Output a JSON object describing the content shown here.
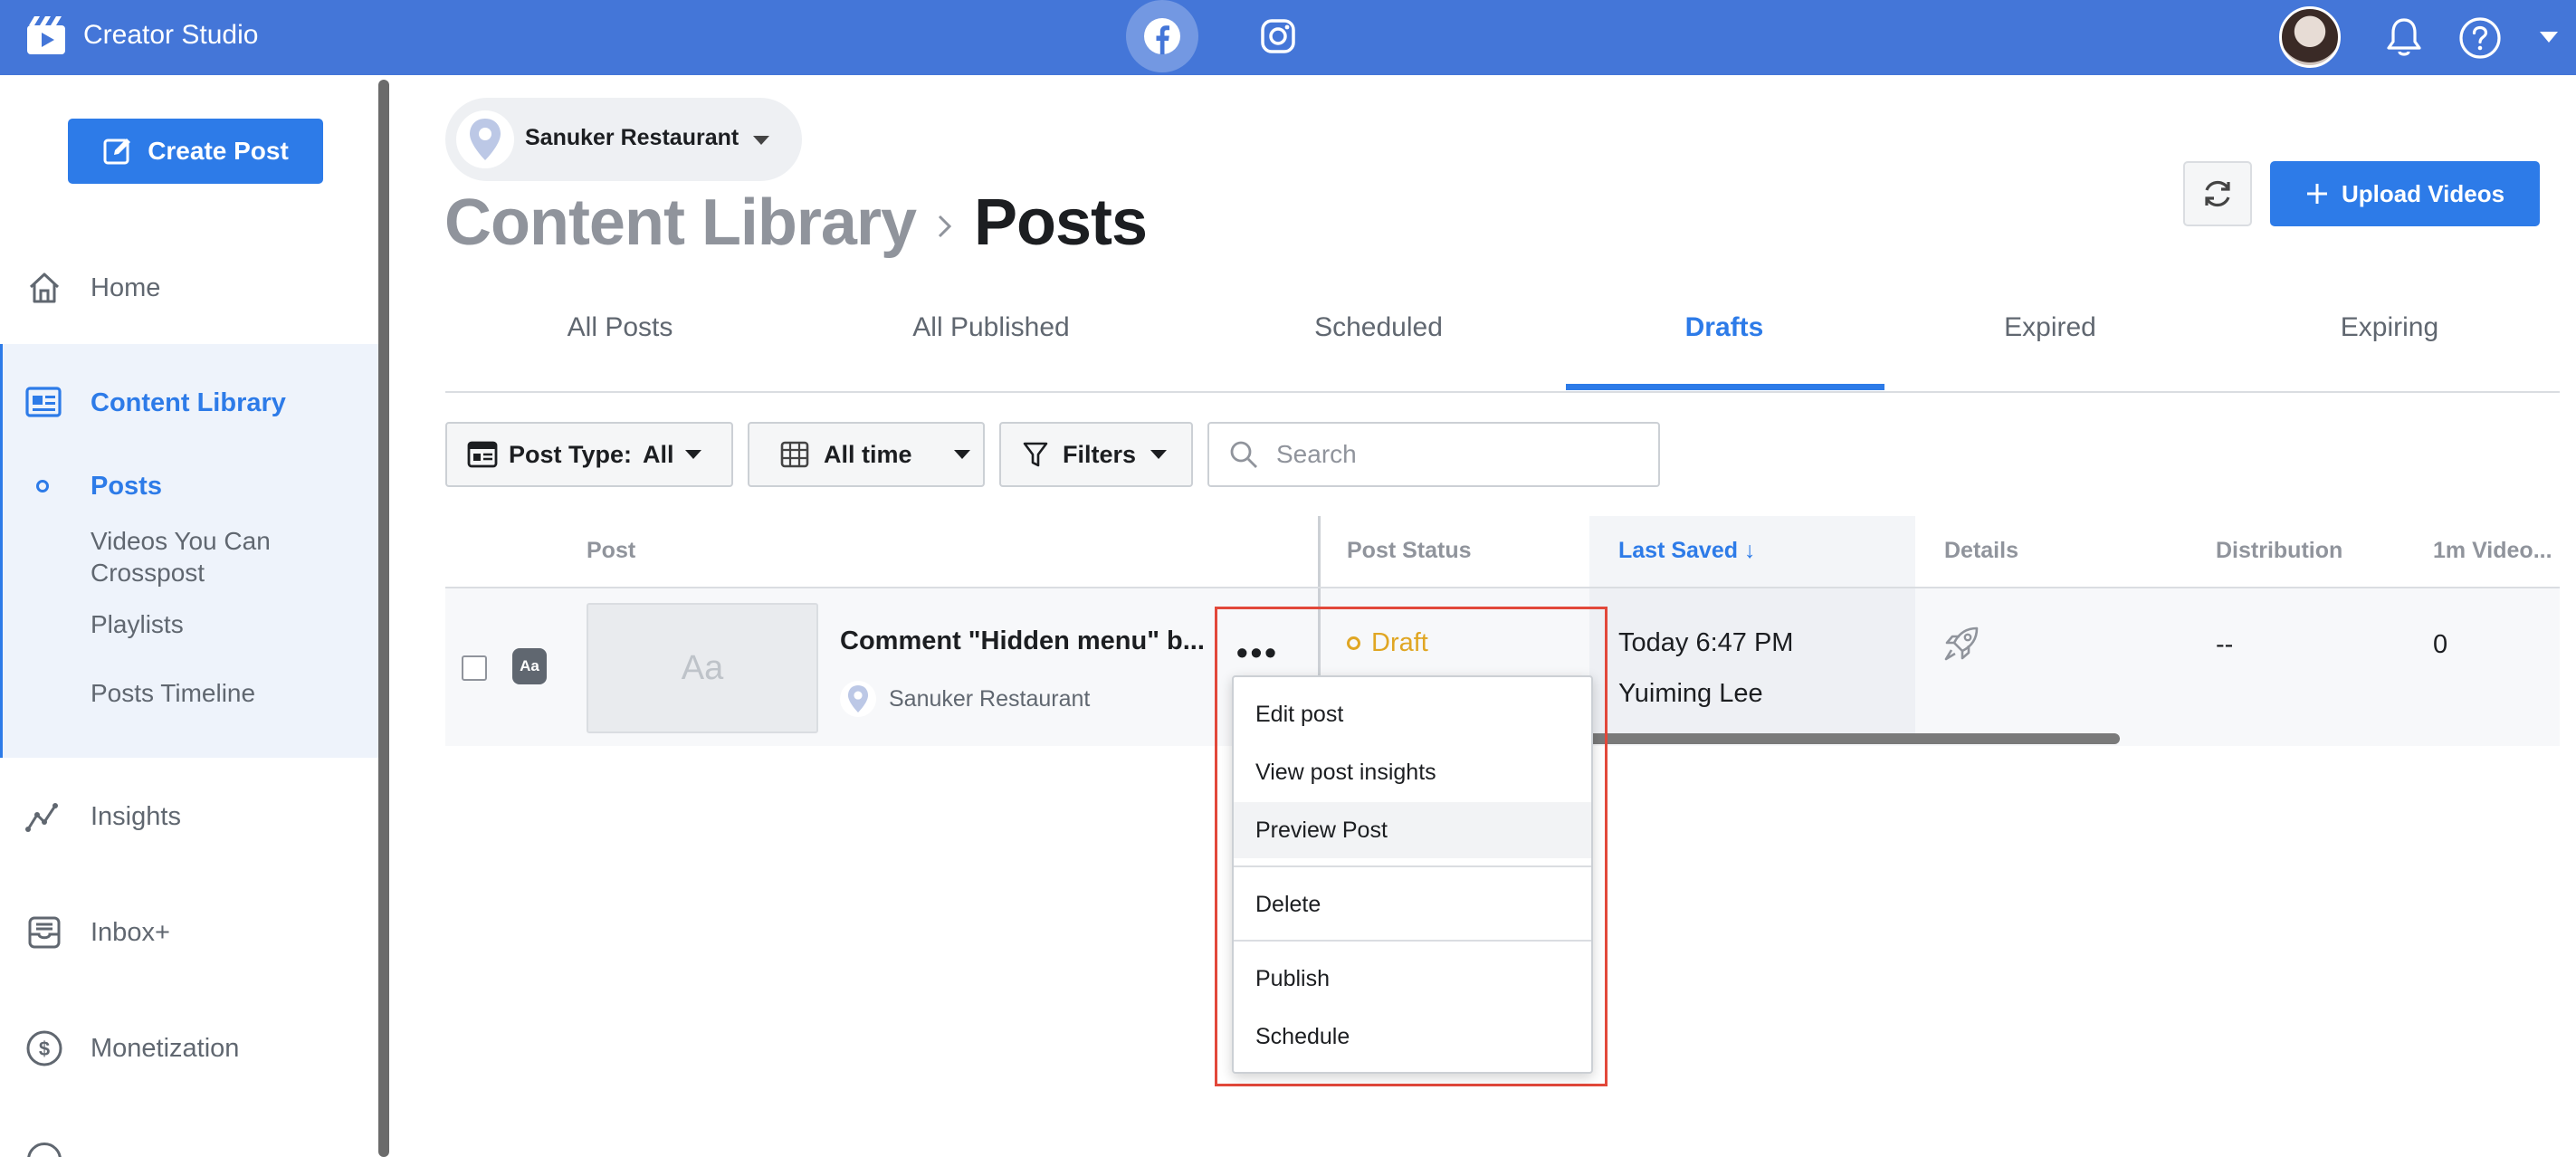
{
  "app": {
    "title": "Creator Studio"
  },
  "topbar": {
    "platforms": [
      "facebook-icon",
      "instagram-icon"
    ],
    "active_platform": "facebook"
  },
  "sidebar": {
    "create_post_label": "Create Post",
    "items": [
      {
        "label": "Home",
        "icon": "home-icon"
      },
      {
        "label": "Content Library",
        "icon": "content-library-icon",
        "active": true
      },
      {
        "label": "Insights",
        "icon": "insights-icon"
      },
      {
        "label": "Inbox+",
        "icon": "inbox-icon"
      },
      {
        "label": "Monetization",
        "icon": "dollar-icon"
      }
    ],
    "sub_items": [
      {
        "label": "Posts",
        "active": true
      },
      {
        "label": "Videos You Can Crosspost"
      },
      {
        "label": "Playlists"
      },
      {
        "label": "Posts Timeline"
      }
    ]
  },
  "page_selector": {
    "name": "Sanuker Restaurant"
  },
  "breadcrumb": {
    "root": "Content Library",
    "leaf": "Posts"
  },
  "actions": {
    "upload_label": "Upload Videos"
  },
  "tabs": [
    {
      "label": "All Posts"
    },
    {
      "label": "All Published"
    },
    {
      "label": "Scheduled"
    },
    {
      "label": "Drafts",
      "active": true
    },
    {
      "label": "Expired"
    },
    {
      "label": "Expiring"
    }
  ],
  "filters": {
    "post_type_label": "Post Type:",
    "post_type_value": "All",
    "time_label": "All time",
    "filters_label": "Filters",
    "search_placeholder": "Search"
  },
  "table": {
    "columns": [
      "Post",
      "Post Status",
      "Last Saved ↓",
      "Details",
      "Distribution",
      "1m Video..."
    ],
    "rows": [
      {
        "type_badge": "Aa",
        "thumbnail_text": "Aa",
        "title": "Comment \"Hidden menu\" b...",
        "page": "Sanuker Restaurant",
        "more": "•••",
        "status": "Draft",
        "last_saved_time": "Today 6:47 PM",
        "last_saved_by": "Yuiming Lee",
        "distribution": "--",
        "video_views": "0"
      }
    ]
  },
  "context_menu": {
    "items": [
      "Edit post",
      "View post insights",
      "Preview Post",
      "Delete",
      "Publish",
      "Schedule"
    ],
    "hovered": "Preview Post"
  },
  "colors": {
    "topbar": "#4476d8",
    "accent": "#2d7be8",
    "draft": "#e0a623",
    "highlight_box": "#e2483a"
  }
}
